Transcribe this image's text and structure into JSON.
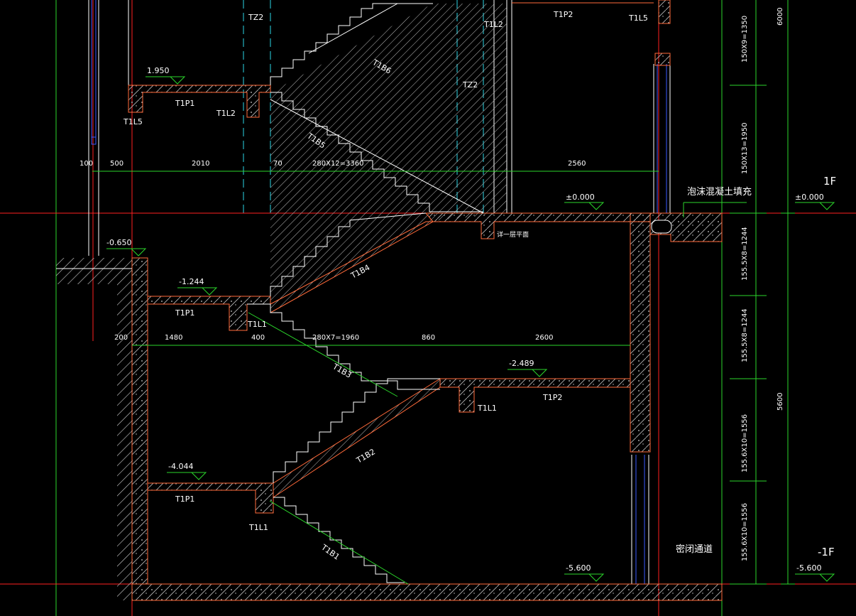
{
  "drawing": {
    "floor_labels": {
      "upper": "1F",
      "lower": "-1F"
    },
    "right_dims": {
      "d1": "150X9=1350",
      "d2": "150X13=1950",
      "d3": "155.5X8=1244",
      "d4": "155.5X8=1244",
      "d5": "155.6X10=1556",
      "d6": "155.6X10=1556",
      "total_upper": "6000",
      "total_lower": "5600"
    },
    "elevations": {
      "e1": "1.950",
      "e2": "±0.000",
      "e3": "±0.000",
      "e4": "-0.650",
      "e5": "-1.244",
      "e6": "-2.489",
      "e7": "-4.044",
      "e8": "-5.600",
      "e9": "-5.600"
    },
    "dims_upper": {
      "a": "100",
      "b": "500",
      "c": "2010",
      "d": "70",
      "e": "280X12=3360",
      "f": "2560"
    },
    "dims_lower": {
      "a": "200",
      "b": "1480",
      "c": "400",
      "d": "280X7=1960",
      "e": "860",
      "f": "2600"
    },
    "members": {
      "tz2_top": "TZ2",
      "tz2_mid": "TZ2",
      "t1p2_top": "T1P2",
      "t1l5_top": "T1L5",
      "t1l2_top": "T1L2",
      "t1b6": "T1B6",
      "t1p1_top": "T1P1",
      "t1l5_left": "T1L5",
      "t1l2_mid": "T1L2",
      "t1b5": "T1B5",
      "t1b4": "T1B4",
      "t1p1_mid": "T1P1",
      "t1l1_mid": "T1L1",
      "t1b3": "T1B3",
      "t1p2_mid": "T1P2",
      "t1l1_right": "T1L1",
      "t1b2": "T1B2",
      "t1p1_low": "T1P1",
      "t1l1_low": "T1L1",
      "t1b1": "T1B1"
    },
    "notes": {
      "foam_fill": "泡沫混凝土填充",
      "level_note": "详一层平面",
      "airtight": "密闭通道"
    },
    "colors": {
      "background": "#000000",
      "slab_outline": "#ff6a3a",
      "dim_green": "#2bd62b",
      "axis_red": "#ff2020",
      "axis_cyan": "#2bd6e6",
      "blue": "#3a5aff",
      "hatch": "#c8c8c8",
      "elev_green": "#2bd62b",
      "line_white": "#ffffff"
    }
  }
}
